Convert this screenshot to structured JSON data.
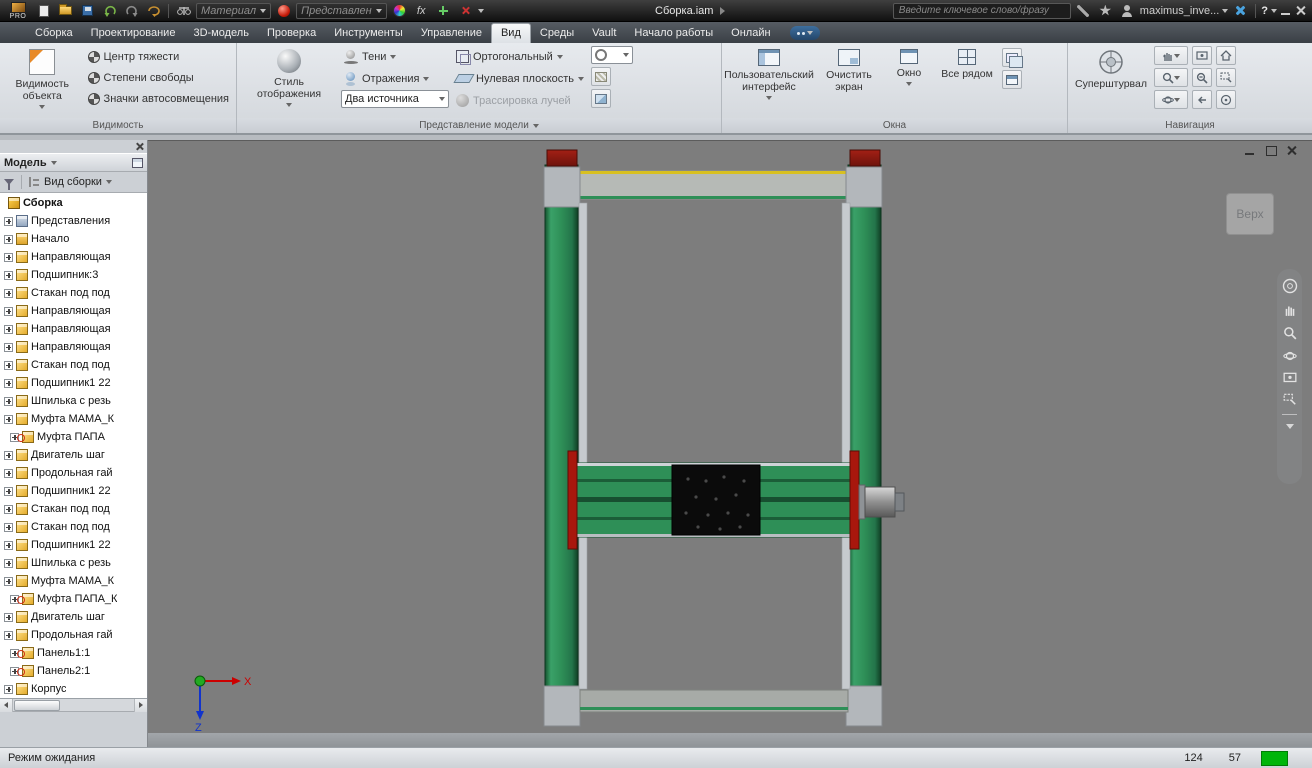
{
  "title_bar": {
    "logo_text": "PRO",
    "material_combo": "Материал",
    "appearance_combo": "Представлен",
    "fx_label": "fx",
    "document_title": "Сборка.iam",
    "search_placeholder": "Введите ключевое слово/фразу",
    "user_name": "maximus_inve...",
    "help_label": "?"
  },
  "ribbon_tabs": [
    {
      "label": "Сборка"
    },
    {
      "label": "Проектирование"
    },
    {
      "label": "3D-модель"
    },
    {
      "label": "Проверка"
    },
    {
      "label": "Инструменты"
    },
    {
      "label": "Управление"
    },
    {
      "label": "Вид",
      "state": "active"
    },
    {
      "label": "Среды"
    },
    {
      "label": "Vault"
    },
    {
      "label": "Начало работы"
    },
    {
      "label": "Онлайн"
    }
  ],
  "ribbon": {
    "visibility": {
      "title": "Видимость",
      "object_visibility": "Видимость объекта",
      "options": [
        {
          "label": "Центр тяжести"
        },
        {
          "label": "Степени свободы"
        },
        {
          "label": "Значки автосовмещения"
        }
      ]
    },
    "model_view": {
      "title": "Представление модели",
      "display_style": "Стиль отображения",
      "shadows": "Тени",
      "reflections": "Отражения",
      "lights_combo": "Два источника",
      "projection": "Ортогональный",
      "ground_plane": "Нулевая плоскость",
      "ray_tracing": "Трассировка лучей"
    },
    "windows": {
      "title": "Окна",
      "user_interface": "Пользовательский интерфейс",
      "clean_screen": "Очистить экран",
      "window": "Окно",
      "tile_all": "Все рядом"
    },
    "navigation": {
      "title": "Навигация",
      "steering_wheel": "Суперштурвал"
    }
  },
  "browser": {
    "title": "Модель",
    "toolbar_view": "Вид сборки",
    "tree": [
      {
        "label": "Сборка",
        "type": "root"
      },
      {
        "label": "Представления",
        "type": "views"
      },
      {
        "label": "Начало",
        "type": "folder"
      },
      {
        "label": "Направляющая",
        "type": "part"
      },
      {
        "label": "Подшипник:3",
        "type": "part"
      },
      {
        "label": "Стакан под под",
        "type": "part"
      },
      {
        "label": "Направляющая",
        "type": "part"
      },
      {
        "label": "Направляющая",
        "type": "part"
      },
      {
        "label": "Направляющая",
        "type": "part"
      },
      {
        "label": "Стакан под под",
        "type": "part"
      },
      {
        "label": "Подшипник1 22",
        "type": "part"
      },
      {
        "label": "Шпилька с резь",
        "type": "part"
      },
      {
        "label": "Муфта МАМА_К",
        "type": "part"
      },
      {
        "label": "Муфта ПАПА",
        "type": "part-red"
      },
      {
        "label": "Двигатель шаг",
        "type": "part"
      },
      {
        "label": "Продольная гай",
        "type": "part"
      },
      {
        "label": "Подшипник1 22",
        "type": "part"
      },
      {
        "label": "Стакан под под",
        "type": "part"
      },
      {
        "label": "Стакан под под",
        "type": "part"
      },
      {
        "label": "Подшипник1 22",
        "type": "part"
      },
      {
        "label": "Шпилька с резь",
        "type": "part"
      },
      {
        "label": "Муфта МАМА_К",
        "type": "part"
      },
      {
        "label": "Муфта ПАПА_К",
        "type": "part-red"
      },
      {
        "label": "Двигатель шаг",
        "type": "part"
      },
      {
        "label": "Продольная гай",
        "type": "part"
      },
      {
        "label": "Панель1:1",
        "type": "part-red"
      },
      {
        "label": "Панель2:1",
        "type": "part-red"
      },
      {
        "label": "Корпус",
        "type": "part"
      }
    ]
  },
  "viewport": {
    "viewcube_face": "Верх",
    "axis_x": "X",
    "axis_z": "Z"
  },
  "status_bar": {
    "message": "Режим ожидания",
    "counters": [
      {
        "value": "124"
      },
      {
        "value": "57"
      }
    ]
  }
}
